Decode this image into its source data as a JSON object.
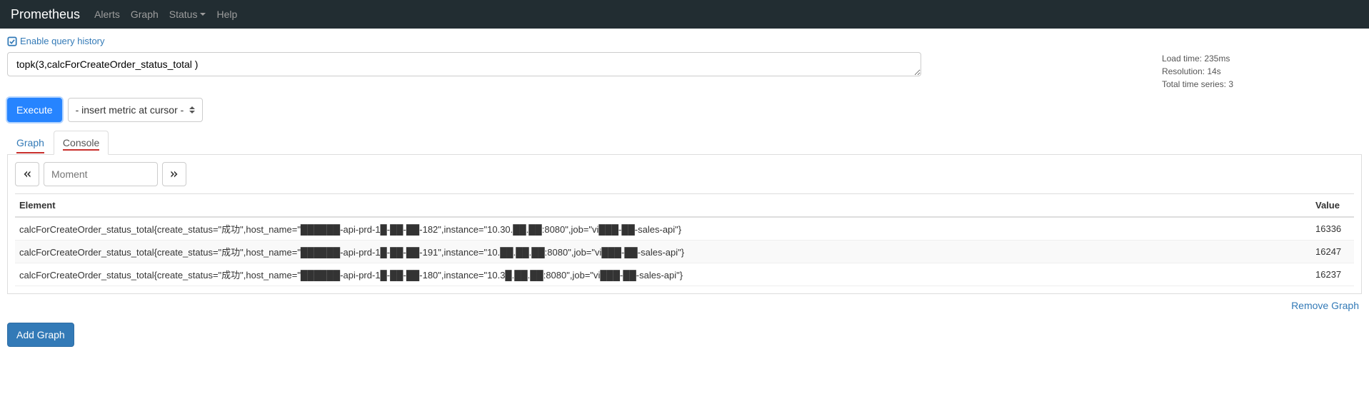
{
  "nav": {
    "brand": "Prometheus",
    "items": [
      "Alerts",
      "Graph",
      "Status",
      "Help"
    ],
    "status_has_dropdown": true
  },
  "history_toggle": "Enable query history",
  "query": {
    "expression": "topk(3,calcForCreateOrder_status_total )",
    "stats": {
      "load_time": "Load time: 235ms",
      "resolution": "Resolution: 14s",
      "total_series": "Total time series: 3"
    }
  },
  "controls": {
    "execute": "Execute",
    "metric_placeholder": "- insert metric at cursor -"
  },
  "tabs": {
    "graph": "Graph",
    "console": "Console"
  },
  "moment": {
    "placeholder": "Moment"
  },
  "table": {
    "headers": {
      "element": "Element",
      "value": "Value"
    },
    "rows": [
      {
        "element": "calcForCreateOrder_status_total{create_status=\"成功\",host_name=\"██████-api-prd-1█-██-██-182\",instance=\"10.30.██.██:8080\",job=\"vi███-██-sales-api\"}",
        "value": "16336"
      },
      {
        "element": "calcForCreateOrder_status_total{create_status=\"成功\",host_name=\"██████-api-prd-1█-██-██-191\",instance=\"10.██.██.██:8080\",job=\"vi███-██-sales-api\"}",
        "value": "16247"
      },
      {
        "element": "calcForCreateOrder_status_total{create_status=\"成功\",host_name=\"██████-api-prd-1█-██-██-180\",instance=\"10.3█.██.██:8080\",job=\"vi███-██-sales-api\"}",
        "value": "16237"
      }
    ]
  },
  "actions": {
    "remove_graph": "Remove Graph",
    "add_graph": "Add Graph"
  }
}
